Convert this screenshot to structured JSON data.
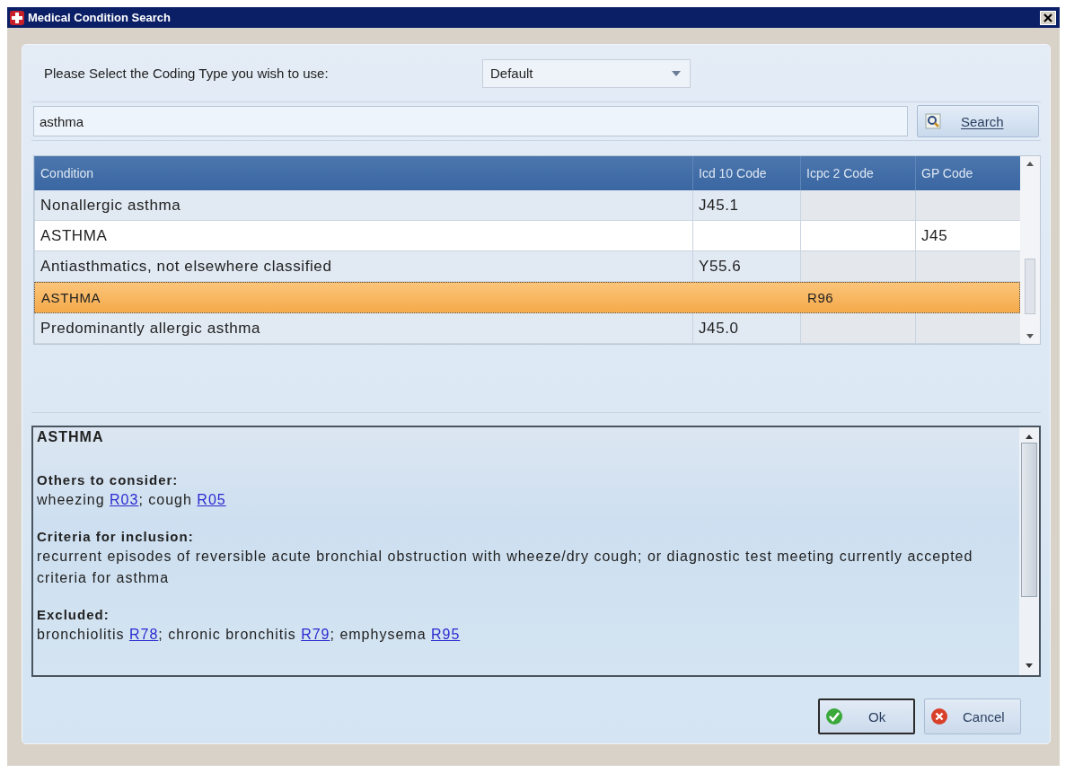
{
  "window": {
    "title": "Medical Condition Search"
  },
  "coding_type": {
    "label": "Please Select the Coding Type you wish to use:",
    "value": "Default"
  },
  "search": {
    "value": "asthma",
    "button": "Search"
  },
  "table": {
    "columns": [
      "Condition",
      "Icd 10 Code",
      "Icpc 2 Code",
      "GP Code"
    ],
    "rows": [
      {
        "cells": [
          "Nonallergic asthma",
          "J45.1",
          "",
          ""
        ],
        "selected": false
      },
      {
        "cells": [
          "ASTHMA",
          "",
          "",
          "J45"
        ],
        "selected": false
      },
      {
        "cells": [
          "Antiasthmatics, not elsewhere classified",
          "Y55.6",
          "",
          ""
        ],
        "selected": false
      },
      {
        "cells": [
          "ASTHMA",
          "",
          "R96",
          ""
        ],
        "selected": true
      },
      {
        "cells": [
          "Predominantly allergic asthma",
          "J45.0",
          "",
          ""
        ],
        "selected": false
      }
    ]
  },
  "details": {
    "heading": "ASTHMA",
    "sections": [
      {
        "title": "Others to consider:",
        "parts": [
          {
            "kind": "text",
            "text": "wheezing "
          },
          {
            "kind": "link",
            "text": "R03"
          },
          {
            "kind": "text",
            "text": "; cough "
          },
          {
            "kind": "link",
            "text": "R05"
          }
        ]
      },
      {
        "title": "Criteria for inclusion:",
        "parts": [
          {
            "kind": "text",
            "text": "recurrent episodes of reversible acute bronchial obstruction with wheeze/dry cough; or diagnostic test meeting currently accepted criteria for asthma"
          }
        ]
      },
      {
        "title": "Excluded:",
        "parts": [
          {
            "kind": "text",
            "text": "bronchiolitis "
          },
          {
            "kind": "link",
            "text": "R78"
          },
          {
            "kind": "text",
            "text": "; chronic bronchitis "
          },
          {
            "kind": "link",
            "text": "R79"
          },
          {
            "kind": "text",
            "text": "; emphysema "
          },
          {
            "kind": "link",
            "text": "R95"
          }
        ]
      }
    ]
  },
  "buttons": [
    {
      "kind": "ok",
      "label": "Ok"
    },
    {
      "kind": "cancel",
      "label": "Cancel"
    }
  ]
}
